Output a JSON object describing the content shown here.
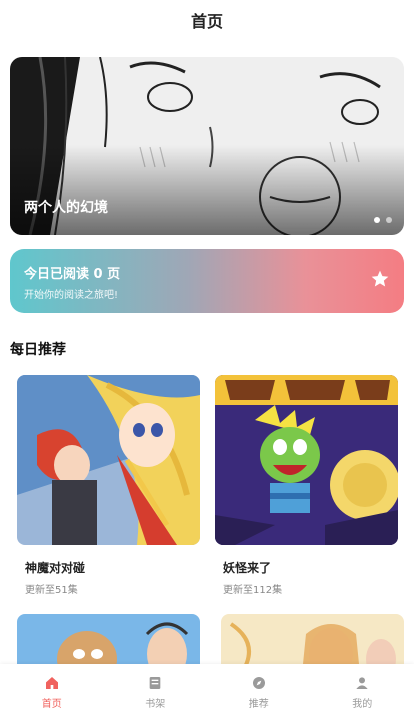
{
  "header": {
    "title": "首页"
  },
  "banner": {
    "title": "两个人的幻境",
    "slide_count": 2,
    "active_slide": 1
  },
  "reading": {
    "main": "今日已阅读 0 页",
    "sub": "开始你的阅读之旅吧!",
    "icon": "star-icon"
  },
  "section": {
    "title": "每日推荐"
  },
  "recommend": [
    {
      "title": "神魔对对碰",
      "sub": "更新至51集"
    },
    {
      "title": "妖怪来了",
      "sub": "更新至112集"
    }
  ],
  "tabs": [
    {
      "label": "首页",
      "icon": "home-icon",
      "active": true
    },
    {
      "label": "书架",
      "icon": "bookshelf-icon",
      "active": false
    },
    {
      "label": "推荐",
      "icon": "compass-icon",
      "active": false
    },
    {
      "label": "我的",
      "icon": "user-icon",
      "active": false
    }
  ],
  "colors": {
    "accent": "#f0625e",
    "gradient_start": "#5fc7cd",
    "gradient_end": "#f47d83"
  }
}
